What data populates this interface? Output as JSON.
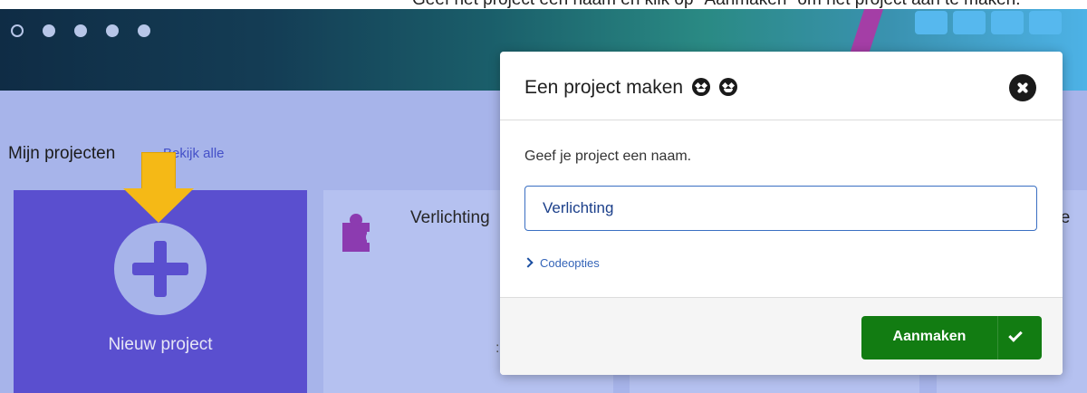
{
  "caption": "Geef het project een naam en klik op \"Aanmaken\" om het project aan te maken.",
  "home": {
    "section_title": "Mijn projecten",
    "view_all": "Bekijk alle",
    "new_project_label": "Nieuw project",
    "projects": [
      {
        "title": "Verlichting"
      },
      {
        "title": ""
      },
      {
        "title": "tve"
      }
    ],
    "card_mark": ":"
  },
  "modal": {
    "title": "Een project maken",
    "title_emoji": "heart-eyes-emoji",
    "prompt": "Geef je project een naam.",
    "name_value": "Verlichting",
    "code_options": "Codeopties",
    "create_label": "Aanmaken"
  },
  "colors": {
    "accent": "#5a4fcf",
    "workspace": "#a7b4ea",
    "create_button": "#127c12",
    "highlight_arrow": "#f5b916",
    "puzzle_icon": "#8c3bb0"
  }
}
